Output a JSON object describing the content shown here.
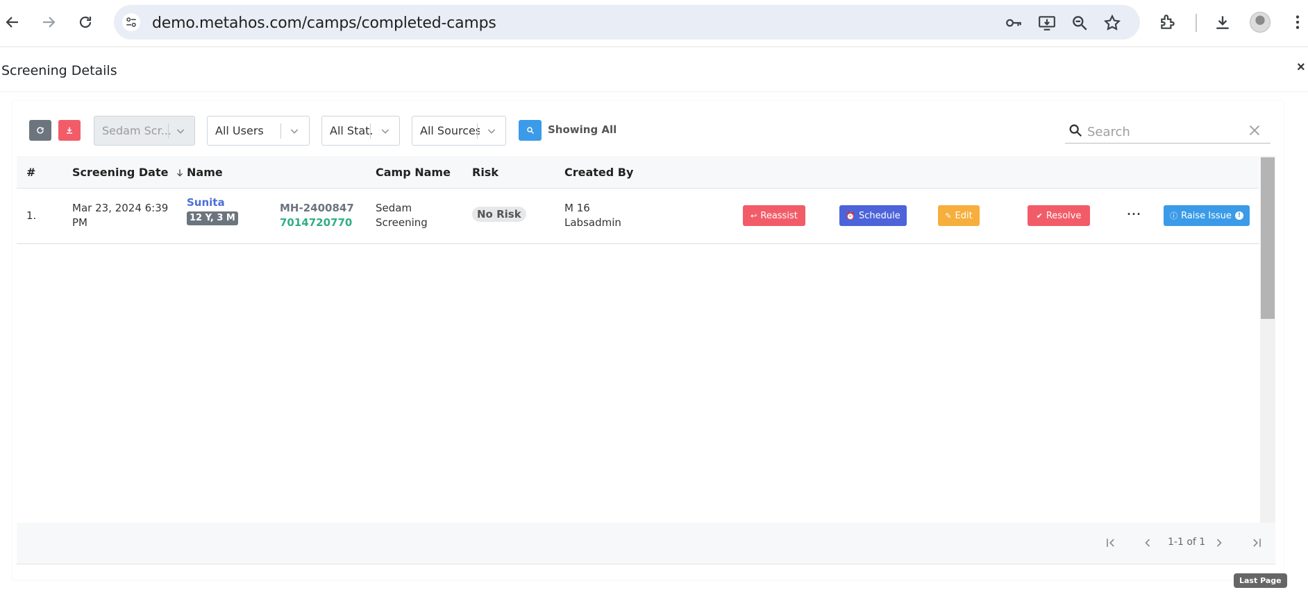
{
  "browser": {
    "url": "demo.metahos.com/camps/completed-camps"
  },
  "dialog": {
    "title": "Screening Details",
    "close_label": "×"
  },
  "filters": {
    "camp_select": "Sedam Scr...",
    "users_select": "All Users",
    "status_select": "All Stat...",
    "sources_select": "All Sources",
    "showing_label": "Showing All",
    "search_placeholder": "Search"
  },
  "table": {
    "headers": {
      "index": "#",
      "date": "Screening Date",
      "name": "Name",
      "camp": "Camp Name",
      "risk": "Risk",
      "created_by": "Created By"
    },
    "rows": [
      {
        "index": "1.",
        "date_line1": "Mar 23, 2024 6:39",
        "date_line2": "PM",
        "name": "Sunita",
        "age": "12 Y, 3 M",
        "mrn": "MH-2400847",
        "phone": "7014720770",
        "camp_line1": "Sedam",
        "camp_line2": "Screening",
        "risk": "No Risk",
        "created_line1": "M 16",
        "created_line2": "Labsadmin",
        "actions": {
          "reassist": "Reassist",
          "schedule": "Schedule",
          "edit": "Edit",
          "resolve": "Resolve",
          "more": "···",
          "raise_issue": "Raise Issue"
        }
      }
    ]
  },
  "pagination": {
    "info": "1-1 of 1",
    "tooltip": "Last Page"
  },
  "colors": {
    "primary": "#3b9be8",
    "danger": "#f25c68",
    "indigo": "#4c63d9",
    "warning": "#f6ae3d",
    "secondary": "#6c757d",
    "success_text": "#2fae85"
  }
}
